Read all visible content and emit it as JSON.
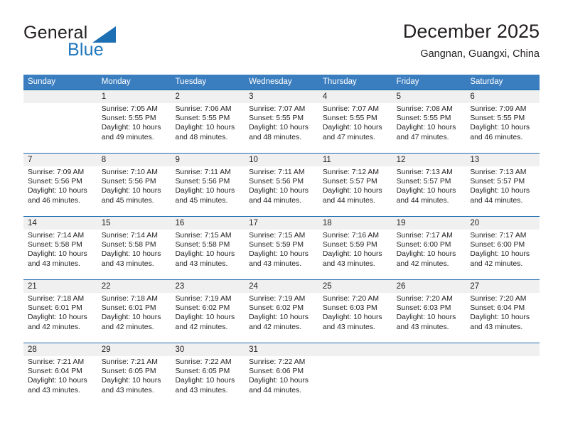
{
  "brand": {
    "name_part1": "General",
    "name_part2": "Blue"
  },
  "header": {
    "month_title": "December 2025",
    "location": "Gangnan, Guangxi, China"
  },
  "colors": {
    "header_blue": "#3b7ebf",
    "rule_blue": "#1f6cb0",
    "daynum_band": "#f0f0f0",
    "brand_blue": "#1d76bc",
    "text": "#231f20"
  },
  "weekdays": [
    "Sunday",
    "Monday",
    "Tuesday",
    "Wednesday",
    "Thursday",
    "Friday",
    "Saturday"
  ],
  "weeks": [
    {
      "days": [
        {
          "num": "",
          "sunrise": "",
          "sunset": "",
          "daylight_line1": "",
          "daylight_line2": ""
        },
        {
          "num": "1",
          "sunrise": "Sunrise: 7:05 AM",
          "sunset": "Sunset: 5:55 PM",
          "daylight_line1": "Daylight: 10 hours",
          "daylight_line2": "and 49 minutes."
        },
        {
          "num": "2",
          "sunrise": "Sunrise: 7:06 AM",
          "sunset": "Sunset: 5:55 PM",
          "daylight_line1": "Daylight: 10 hours",
          "daylight_line2": "and 48 minutes."
        },
        {
          "num": "3",
          "sunrise": "Sunrise: 7:07 AM",
          "sunset": "Sunset: 5:55 PM",
          "daylight_line1": "Daylight: 10 hours",
          "daylight_line2": "and 48 minutes."
        },
        {
          "num": "4",
          "sunrise": "Sunrise: 7:07 AM",
          "sunset": "Sunset: 5:55 PM",
          "daylight_line1": "Daylight: 10 hours",
          "daylight_line2": "and 47 minutes."
        },
        {
          "num": "5",
          "sunrise": "Sunrise: 7:08 AM",
          "sunset": "Sunset: 5:55 PM",
          "daylight_line1": "Daylight: 10 hours",
          "daylight_line2": "and 47 minutes."
        },
        {
          "num": "6",
          "sunrise": "Sunrise: 7:09 AM",
          "sunset": "Sunset: 5:55 PM",
          "daylight_line1": "Daylight: 10 hours",
          "daylight_line2": "and 46 minutes."
        }
      ]
    },
    {
      "days": [
        {
          "num": "7",
          "sunrise": "Sunrise: 7:09 AM",
          "sunset": "Sunset: 5:56 PM",
          "daylight_line1": "Daylight: 10 hours",
          "daylight_line2": "and 46 minutes."
        },
        {
          "num": "8",
          "sunrise": "Sunrise: 7:10 AM",
          "sunset": "Sunset: 5:56 PM",
          "daylight_line1": "Daylight: 10 hours",
          "daylight_line2": "and 45 minutes."
        },
        {
          "num": "9",
          "sunrise": "Sunrise: 7:11 AM",
          "sunset": "Sunset: 5:56 PM",
          "daylight_line1": "Daylight: 10 hours",
          "daylight_line2": "and 45 minutes."
        },
        {
          "num": "10",
          "sunrise": "Sunrise: 7:11 AM",
          "sunset": "Sunset: 5:56 PM",
          "daylight_line1": "Daylight: 10 hours",
          "daylight_line2": "and 44 minutes."
        },
        {
          "num": "11",
          "sunrise": "Sunrise: 7:12 AM",
          "sunset": "Sunset: 5:57 PM",
          "daylight_line1": "Daylight: 10 hours",
          "daylight_line2": "and 44 minutes."
        },
        {
          "num": "12",
          "sunrise": "Sunrise: 7:13 AM",
          "sunset": "Sunset: 5:57 PM",
          "daylight_line1": "Daylight: 10 hours",
          "daylight_line2": "and 44 minutes."
        },
        {
          "num": "13",
          "sunrise": "Sunrise: 7:13 AM",
          "sunset": "Sunset: 5:57 PM",
          "daylight_line1": "Daylight: 10 hours",
          "daylight_line2": "and 44 minutes."
        }
      ]
    },
    {
      "days": [
        {
          "num": "14",
          "sunrise": "Sunrise: 7:14 AM",
          "sunset": "Sunset: 5:58 PM",
          "daylight_line1": "Daylight: 10 hours",
          "daylight_line2": "and 43 minutes."
        },
        {
          "num": "15",
          "sunrise": "Sunrise: 7:14 AM",
          "sunset": "Sunset: 5:58 PM",
          "daylight_line1": "Daylight: 10 hours",
          "daylight_line2": "and 43 minutes."
        },
        {
          "num": "16",
          "sunrise": "Sunrise: 7:15 AM",
          "sunset": "Sunset: 5:58 PM",
          "daylight_line1": "Daylight: 10 hours",
          "daylight_line2": "and 43 minutes."
        },
        {
          "num": "17",
          "sunrise": "Sunrise: 7:15 AM",
          "sunset": "Sunset: 5:59 PM",
          "daylight_line1": "Daylight: 10 hours",
          "daylight_line2": "and 43 minutes."
        },
        {
          "num": "18",
          "sunrise": "Sunrise: 7:16 AM",
          "sunset": "Sunset: 5:59 PM",
          "daylight_line1": "Daylight: 10 hours",
          "daylight_line2": "and 43 minutes."
        },
        {
          "num": "19",
          "sunrise": "Sunrise: 7:17 AM",
          "sunset": "Sunset: 6:00 PM",
          "daylight_line1": "Daylight: 10 hours",
          "daylight_line2": "and 42 minutes."
        },
        {
          "num": "20",
          "sunrise": "Sunrise: 7:17 AM",
          "sunset": "Sunset: 6:00 PM",
          "daylight_line1": "Daylight: 10 hours",
          "daylight_line2": "and 42 minutes."
        }
      ]
    },
    {
      "days": [
        {
          "num": "21",
          "sunrise": "Sunrise: 7:18 AM",
          "sunset": "Sunset: 6:01 PM",
          "daylight_line1": "Daylight: 10 hours",
          "daylight_line2": "and 42 minutes."
        },
        {
          "num": "22",
          "sunrise": "Sunrise: 7:18 AM",
          "sunset": "Sunset: 6:01 PM",
          "daylight_line1": "Daylight: 10 hours",
          "daylight_line2": "and 42 minutes."
        },
        {
          "num": "23",
          "sunrise": "Sunrise: 7:19 AM",
          "sunset": "Sunset: 6:02 PM",
          "daylight_line1": "Daylight: 10 hours",
          "daylight_line2": "and 42 minutes."
        },
        {
          "num": "24",
          "sunrise": "Sunrise: 7:19 AM",
          "sunset": "Sunset: 6:02 PM",
          "daylight_line1": "Daylight: 10 hours",
          "daylight_line2": "and 42 minutes."
        },
        {
          "num": "25",
          "sunrise": "Sunrise: 7:20 AM",
          "sunset": "Sunset: 6:03 PM",
          "daylight_line1": "Daylight: 10 hours",
          "daylight_line2": "and 43 minutes."
        },
        {
          "num": "26",
          "sunrise": "Sunrise: 7:20 AM",
          "sunset": "Sunset: 6:03 PM",
          "daylight_line1": "Daylight: 10 hours",
          "daylight_line2": "and 43 minutes."
        },
        {
          "num": "27",
          "sunrise": "Sunrise: 7:20 AM",
          "sunset": "Sunset: 6:04 PM",
          "daylight_line1": "Daylight: 10 hours",
          "daylight_line2": "and 43 minutes."
        }
      ]
    },
    {
      "days": [
        {
          "num": "28",
          "sunrise": "Sunrise: 7:21 AM",
          "sunset": "Sunset: 6:04 PM",
          "daylight_line1": "Daylight: 10 hours",
          "daylight_line2": "and 43 minutes."
        },
        {
          "num": "29",
          "sunrise": "Sunrise: 7:21 AM",
          "sunset": "Sunset: 6:05 PM",
          "daylight_line1": "Daylight: 10 hours",
          "daylight_line2": "and 43 minutes."
        },
        {
          "num": "30",
          "sunrise": "Sunrise: 7:22 AM",
          "sunset": "Sunset: 6:05 PM",
          "daylight_line1": "Daylight: 10 hours",
          "daylight_line2": "and 43 minutes."
        },
        {
          "num": "31",
          "sunrise": "Sunrise: 7:22 AM",
          "sunset": "Sunset: 6:06 PM",
          "daylight_line1": "Daylight: 10 hours",
          "daylight_line2": "and 44 minutes."
        },
        {
          "num": "",
          "sunrise": "",
          "sunset": "",
          "daylight_line1": "",
          "daylight_line2": ""
        },
        {
          "num": "",
          "sunrise": "",
          "sunset": "",
          "daylight_line1": "",
          "daylight_line2": ""
        },
        {
          "num": "",
          "sunrise": "",
          "sunset": "",
          "daylight_line1": "",
          "daylight_line2": ""
        }
      ]
    }
  ]
}
